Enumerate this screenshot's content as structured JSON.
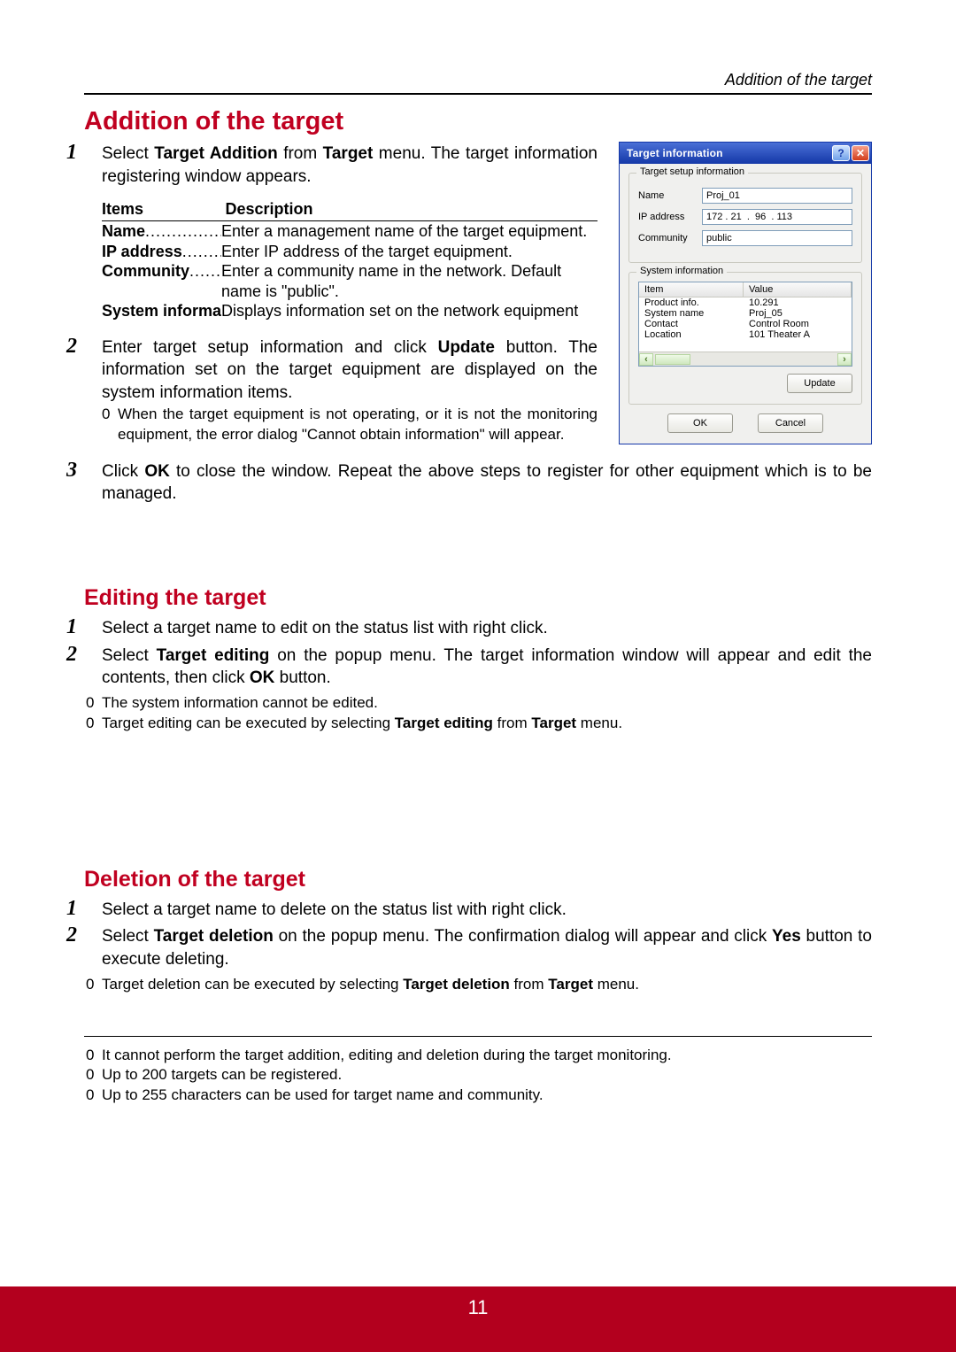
{
  "running_head": "Addition of the target",
  "page_number": "11",
  "sections": {
    "addition": {
      "title": "Addition of the target",
      "step1_pre": "Select ",
      "step1_b1": "Target Addition",
      "step1_mid": " from ",
      "step1_b2": "Target",
      "step1_post": " menu. The target information registering window appears.",
      "table": {
        "head_items": "Items",
        "head_desc": "Description",
        "rows": [
          {
            "item": "Name",
            "dots": ".........................",
            "desc": "Enter a management name of the target equipment."
          },
          {
            "item": "IP address",
            "dots": "...............",
            "desc": "Enter IP address of the target equipment."
          },
          {
            "item": "Community",
            "dots": "...........",
            "desc": "Enter a community name in the network. Default name is \"public\"."
          },
          {
            "item": "System information",
            "dots": ".....",
            "desc": "Displays information set on the network equipment"
          }
        ]
      },
      "step2_pre": "Enter target setup information and click ",
      "step2_b1": "Update",
      "step2_post": " button. The information set on the target equipment are displayed on the system information items.",
      "step2_note": "When the target equipment is not operating, or it is not the monitoring equipment, the error dialog \"Cannot obtain  information\" will appear.",
      "step3_pre": "Click ",
      "step3_b1": "OK",
      "step3_post": " to close the window. Repeat the above steps to register for other equipment which is to be managed."
    },
    "editing": {
      "title": "Editing the target",
      "step1": "Select a target name to edit on the status list with right click.",
      "step2_pre": "Select ",
      "step2_b1": "Target editing",
      "step2_mid": " on the popup menu. The target information window will appear and edit the contents, then click ",
      "step2_b2": "OK",
      "step2_post": " button.",
      "note1": "The system information cannot be edited.",
      "note2_pre": "Target editing can be executed by selecting ",
      "note2_b1": "Target editing",
      "note2_mid": " from ",
      "note2_b2": "Target",
      "note2_post": " menu."
    },
    "deletion": {
      "title": "Deletion of the target",
      "step1": "Select a target name to delete on the status list with right click.",
      "step2_pre": "Select ",
      "step2_b1": "Target deletion",
      "step2_mid": " on the popup menu. The confirmation dialog will appear and click ",
      "step2_b2": "Yes",
      "step2_post": " button to execute deleting.",
      "note1_pre": "Target deletion can be executed by selecting ",
      "note1_b1": "Target deletion",
      "note1_mid": " from ",
      "note1_b2": "Target",
      "note1_post": " menu."
    },
    "footnotes": {
      "n1": "It cannot perform the target addition, editing and deletion during the target monitoring.",
      "n2": "Up to 200 targets can be registered.",
      "n3": "Up to 255 characters can be used for target name and community."
    }
  },
  "dialog": {
    "title": "Target information",
    "help": "?",
    "close": "✕",
    "group1": "Target setup information",
    "name_label": "Name",
    "name_value": "Proj_01",
    "ip_label": "IP address",
    "ip_value": "172 . 21  .  96  . 113",
    "community_label": "Community",
    "community_value": "public",
    "group2": "System information",
    "col_item": "Item",
    "col_value": "Value",
    "rows": [
      {
        "item": "Product info.",
        "value": "10.291"
      },
      {
        "item": "System name",
        "value": "Proj_05"
      },
      {
        "item": "Contact",
        "value": "Control Room"
      },
      {
        "item": "Location",
        "value": "101 Theater A"
      }
    ],
    "update": "Update",
    "ok": "OK",
    "cancel": "Cancel"
  }
}
